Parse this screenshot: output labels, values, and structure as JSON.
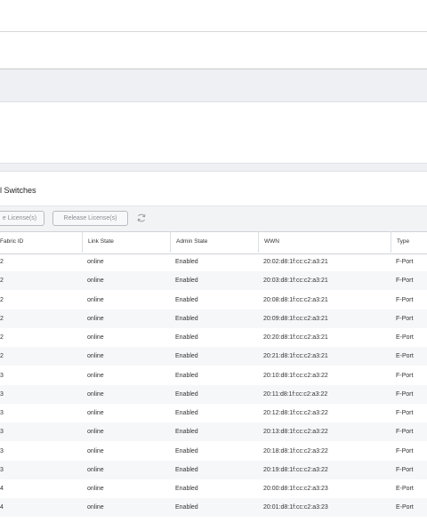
{
  "panel": {
    "title": "l Switches"
  },
  "toolbar": {
    "acquire_label": "e License(s)",
    "release_label": "Release License(s)"
  },
  "table": {
    "columns": [
      "Fabric ID",
      "Link State",
      "Admin State",
      "WWN",
      "Type"
    ],
    "rows": [
      [
        "2",
        "online",
        "Enabled",
        "20:02:d8:1f:cc:c2:a3:21",
        "F-Port"
      ],
      [
        "2",
        "online",
        "Enabled",
        "20:03:d8:1f:cc:c2:a3:21",
        "F-Port"
      ],
      [
        "2",
        "online",
        "Enabled",
        "20:08:d8:1f:cc:c2:a3:21",
        "F-Port"
      ],
      [
        "2",
        "online",
        "Enabled",
        "20:09:d8:1f:cc:c2:a3:21",
        "F-Port"
      ],
      [
        "2",
        "online",
        "Enabled",
        "20:20:d8:1f:cc:c2:a3:21",
        "E-Port"
      ],
      [
        "2",
        "online",
        "Enabled",
        "20:21:d8:1f:cc:c2:a3:21",
        "E-Port"
      ],
      [
        "3",
        "online",
        "Enabled",
        "20:10:d8:1f:cc:c2:a3:22",
        "F-Port"
      ],
      [
        "3",
        "online",
        "Enabled",
        "20:11:d8:1f:cc:c2:a3:22",
        "F-Port"
      ],
      [
        "3",
        "online",
        "Enabled",
        "20:12:d8:1f:cc:c2:a3:22",
        "F-Port"
      ],
      [
        "3",
        "online",
        "Enabled",
        "20:13:d8:1f:cc:c2:a3:22",
        "F-Port"
      ],
      [
        "3",
        "online",
        "Enabled",
        "20:18:d8:1f:cc:c2:a3:22",
        "F-Port"
      ],
      [
        "3",
        "online",
        "Enabled",
        "20:19:d8:1f:cc:c2:a3:22",
        "F-Port"
      ],
      [
        "4",
        "online",
        "Enabled",
        "20:00:d8:1f:cc:c2:a3:23",
        "E-Port"
      ],
      [
        "4",
        "online",
        "Enabled",
        "20:01:d8:1f:cc:c2:a3:23",
        "E-Port"
      ]
    ]
  },
  "icons": {
    "refresh": "refresh-icon"
  }
}
